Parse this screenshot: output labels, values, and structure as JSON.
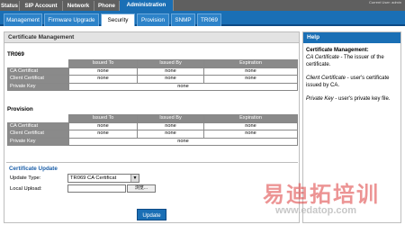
{
  "top_nav": {
    "tabs": [
      "Status",
      "SIP Account",
      "Network",
      "Phone",
      "Administration"
    ],
    "active": "Administration",
    "user_text": "Current User: admin"
  },
  "sub_nav": {
    "tabs": [
      "Management",
      "Firmware Upgrade",
      "Security",
      "Provision",
      "SNMP",
      "TR069"
    ],
    "active": "Security"
  },
  "main": {
    "title": "Certificate Management",
    "tr069": {
      "title": "TR069",
      "columns": [
        "Issued To",
        "Issued By",
        "Expiration"
      ],
      "rows": [
        {
          "label": "CA Certificat",
          "issued_to": "none",
          "issued_by": "none",
          "expiration": "none"
        },
        {
          "label": "Client Certificat",
          "issued_to": "none",
          "issued_by": "none",
          "expiration": "none"
        }
      ],
      "private_key": {
        "label": "Private Key",
        "value": "none"
      }
    },
    "provision": {
      "title": "Provision",
      "columns": [
        "Issued To",
        "Issued By",
        "Expiration"
      ],
      "rows": [
        {
          "label": "CA Certificat",
          "issued_to": "none",
          "issued_by": "none",
          "expiration": "none"
        },
        {
          "label": "Client Certificat",
          "issued_to": "none",
          "issued_by": "none",
          "expiration": "none"
        }
      ],
      "private_key": {
        "label": "Private Key",
        "value": "none"
      }
    },
    "update": {
      "title": "Certificate Update",
      "update_type_label": "Update Type:",
      "update_type_value": "TR069 CA Certificat",
      "local_upload_label": "Local Upload:",
      "browse_label": "浏览..."
    },
    "update_button": "Update"
  },
  "help": {
    "title": "Help",
    "heading": "Certificate Management:",
    "items": [
      {
        "term": "CA Certificate",
        "desc": " - The issuer of the certificate."
      },
      {
        "term": "Client Certificate",
        "desc": " - user's certificate issued by CA."
      },
      {
        "term": "Private Key",
        "desc": " - user's private key file."
      }
    ]
  },
  "watermark": {
    "line1": "易迪拓培训",
    "line2": "www.edatop.com"
  }
}
